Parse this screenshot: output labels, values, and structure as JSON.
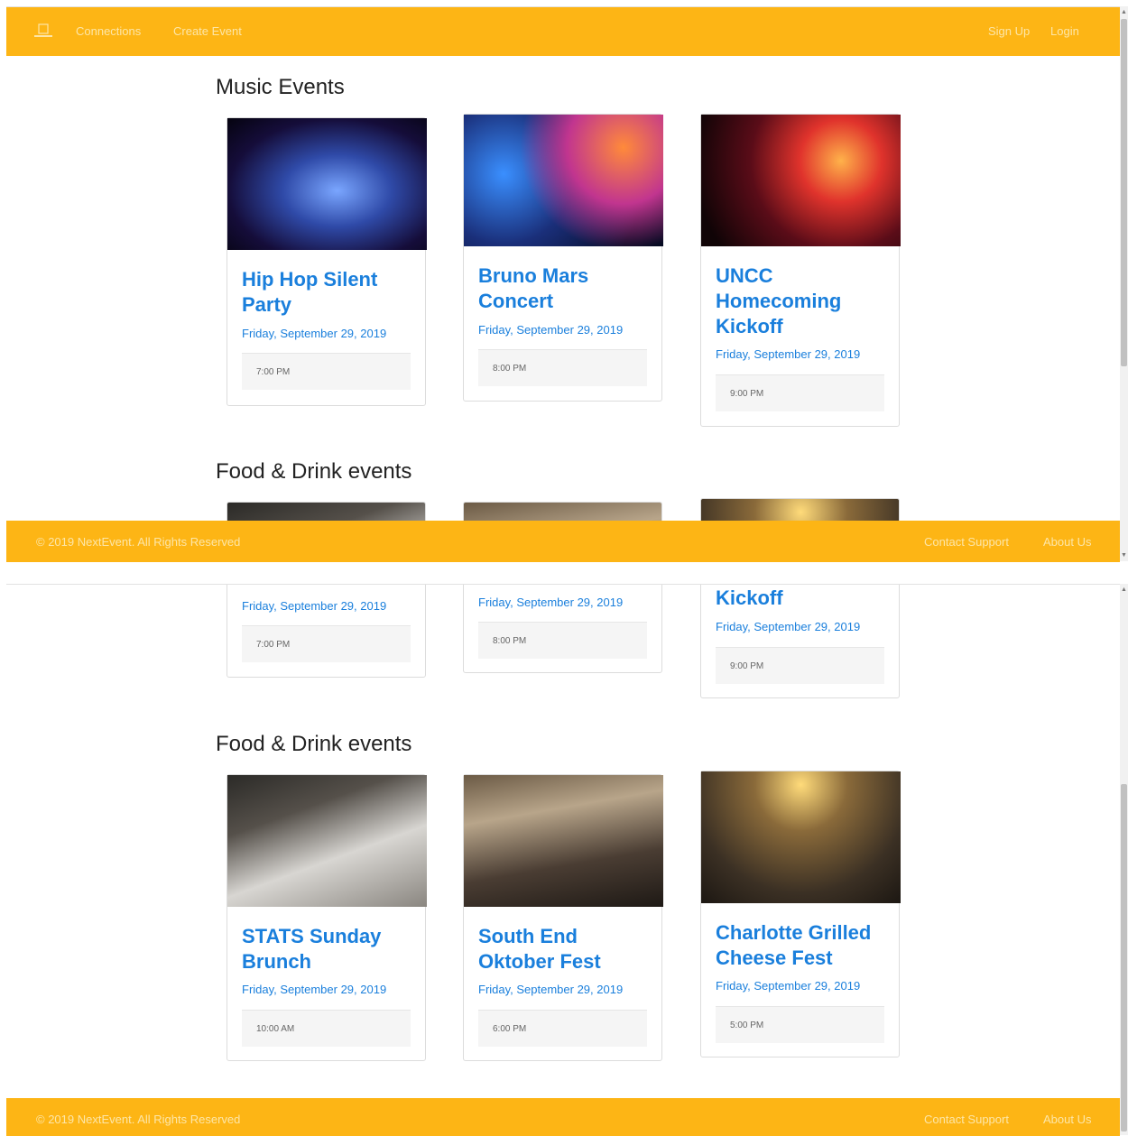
{
  "navbar": {
    "logo_name": "logo-icon",
    "links": [
      "Connections",
      "Create Event"
    ],
    "right_links": [
      "Sign Up",
      "Login"
    ]
  },
  "footer": {
    "copyright": "© 2019 NextEvent. All Rights Reserved",
    "links": [
      "Contact Support",
      "About Us"
    ]
  },
  "sections": {
    "music": {
      "title": "Music Events",
      "events": [
        {
          "title": "Hip Hop Silent Party",
          "date": "Friday, September 29, 2019",
          "time": "7:00 PM",
          "image": "concert-confetti-image"
        },
        {
          "title": "Bruno Mars Concert",
          "date": "Friday, September 29, 2019",
          "time": "8:00 PM",
          "image": "microphone-stage-image"
        },
        {
          "title": "UNCC Homecoming Kickoff",
          "date": "Friday, September 29, 2019",
          "time": "9:00 PM",
          "image": "crowd-lights-image"
        }
      ]
    },
    "food": {
      "title": "Food & Drink events",
      "events": [
        {
          "title": "STATS Sunday Brunch",
          "date": "Friday, September 29, 2019",
          "time": "10:00 AM",
          "image": "dining-table-image"
        },
        {
          "title": "South End Oktober Fest",
          "date": "Friday, September 29, 2019",
          "time": "6:00 PM",
          "image": "crowded-dinner-image"
        },
        {
          "title": "Charlotte Grilled Cheese Fest",
          "date": "Friday, September 29, 2019",
          "time": "5:00 PM",
          "image": "toast-party-image"
        }
      ]
    }
  },
  "partial": {
    "kickoff_fragment": "Kickoff"
  },
  "colors": {
    "brand": "#fdb515",
    "link": "#1a7fdc"
  }
}
